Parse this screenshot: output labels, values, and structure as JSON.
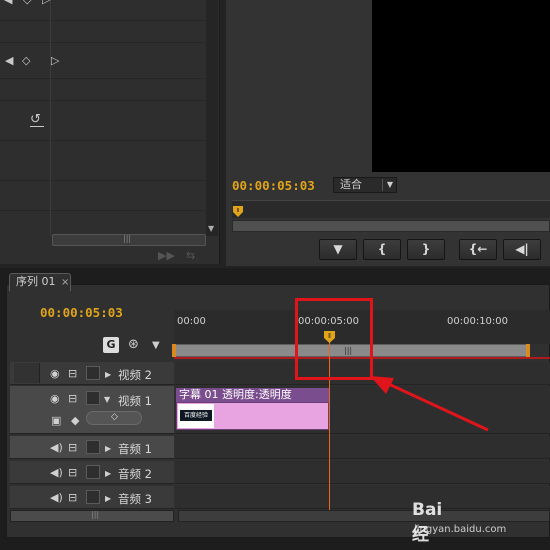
{
  "effect_panel": {
    "nav_prev_icon": "triangle-left",
    "keyframe_icon": "diamond",
    "nav_next_icon": "triangle-right",
    "reset_icon": "reset-arrow"
  },
  "program_monitor": {
    "timecode": "00:00:05:03",
    "fit_select": {
      "value": "适合"
    },
    "buttons": [
      {
        "icon": "marker-icon",
        "glyph": "▼"
      },
      {
        "icon": "in-point-icon",
        "glyph": "{"
      },
      {
        "icon": "out-point-icon",
        "glyph": "}"
      },
      {
        "icon": "go-to-in-icon",
        "glyph": "{←"
      },
      {
        "icon": "step-back-icon",
        "glyph": "◀|"
      }
    ]
  },
  "sequence": {
    "tab_label": "序列 01",
    "tab_close": "×",
    "timecode": "00:00:05:03",
    "ruler": [
      "00:00",
      "00:00:05:00",
      "00:00:10:00"
    ],
    "tracks": [
      {
        "name": "视频 2",
        "kind": "video"
      },
      {
        "name": "视频 1",
        "kind": "video"
      },
      {
        "name": "音频 1",
        "kind": "audio"
      },
      {
        "name": "音频 2",
        "kind": "audio"
      },
      {
        "name": "音频 3",
        "kind": "audio"
      }
    ],
    "clip": {
      "label": "字幕 01 透明度:透明度",
      "thumb_text": "百度经验"
    }
  },
  "colors": {
    "timecode": "#e0a419",
    "playhead": "#e66a1e",
    "annotation": "#e0141b",
    "clip_title": "#7a4e8e",
    "clip_body": "#e7a4e0"
  },
  "watermark": {
    "brand": "Bai 经验",
    "url": "jingyan.baidu.com"
  }
}
